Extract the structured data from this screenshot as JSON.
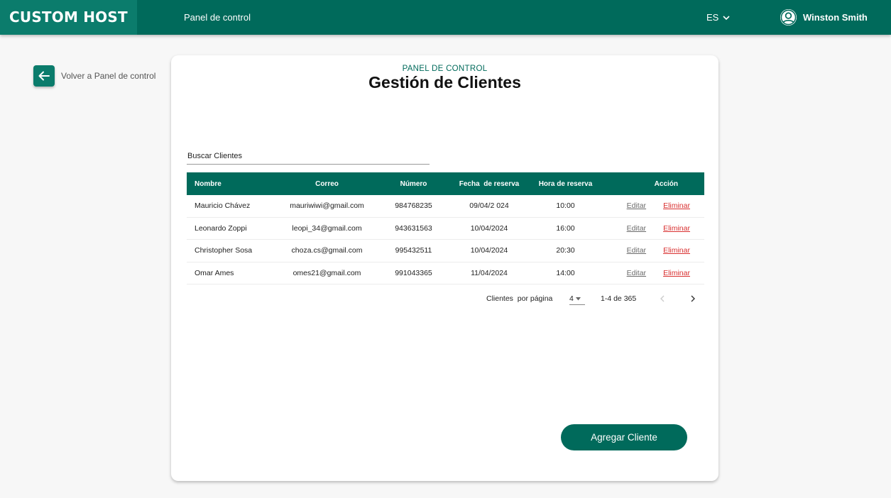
{
  "header": {
    "brand": "CUSTOM HOST",
    "nav_link": "Panel de control",
    "language": "ES",
    "user_name": "Winston Smith"
  },
  "back": {
    "label": "Volver a Panel de control"
  },
  "card": {
    "eyebrow": "PANEL DE CONTROL",
    "title": "Gestión de Clientes"
  },
  "search": {
    "placeholder": "Buscar Clientes"
  },
  "table": {
    "headers": [
      "Nombre",
      "Correo",
      "Número",
      "Fecha  de reserva",
      "Hora de reserva",
      "Acción"
    ],
    "rows": [
      {
        "name": "Mauricio Chávez",
        "email": "mauriwiwi@gmail.com",
        "number": "984768235",
        "date": "09/04/2 024",
        "time": "10:00"
      },
      {
        "name": "Leonardo Zoppi",
        "email": "leopi_34@gmail.com",
        "number": "943631563",
        "date": "10/04/2024",
        "time": "16:00"
      },
      {
        "name": "Christopher Sosa",
        "email": "choza.cs@gmail.com",
        "number": "995432511",
        "date": "10/04/2024",
        "time": "20:30"
      },
      {
        "name": "Omar Ames",
        "email": "omes21@gmail.com",
        "number": "991043365",
        "date": "11/04/2024",
        "time": "14:00"
      }
    ],
    "edit_label": "Editar",
    "delete_label": "Eliminar"
  },
  "pagination": {
    "per_page_label": "Clientes  por página",
    "per_page_value": "4",
    "range": "1-4 de 365"
  },
  "add_button": {
    "label": "Agregar Cliente"
  },
  "colors": {
    "primary": "#006a5b",
    "brand_bg": "#0b7c6c",
    "delete": "#d93030",
    "background": "#f7f7f7"
  },
  "icons": {
    "language_chevron": "chevron-down-icon",
    "user": "user-avatar-icon",
    "back": "arrow-left-icon",
    "prev": "chevron-left-icon",
    "next": "chevron-right-icon"
  }
}
